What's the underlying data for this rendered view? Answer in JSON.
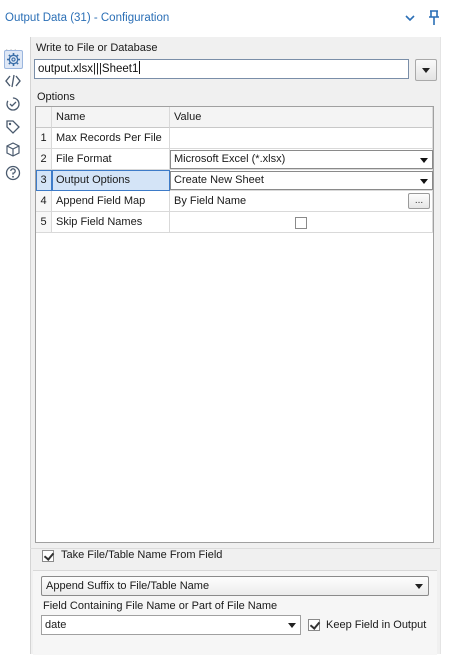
{
  "header": {
    "title": "Output Data (31) - Configuration"
  },
  "sidebar": {
    "more": "...",
    "tools": [
      "gear-icon",
      "xml-icon",
      "anchor-icon",
      "tag-icon",
      "cube-icon",
      "help-icon"
    ]
  },
  "target": {
    "label": "Write to File or Database",
    "value": "output.xlsx|||Sheet1"
  },
  "options": {
    "label": "Options",
    "columns": [
      "Name",
      "Value"
    ],
    "rows": [
      {
        "num": "1",
        "name": "Max Records Per File",
        "value": ""
      },
      {
        "num": "2",
        "name": "File Format",
        "value": "Microsoft Excel (*.xlsx)"
      },
      {
        "num": "3",
        "name": "Output Options",
        "value": "Create New Sheet"
      },
      {
        "num": "4",
        "name": "Append Field Map",
        "value": "By Field Name",
        "button": "..."
      },
      {
        "num": "5",
        "name": "Skip Field Names",
        "checked": false
      }
    ]
  },
  "bottom": {
    "take_name_label": "Take File/Table Name From Field",
    "take_name_checked": true,
    "suffix_option": "Append Suffix to File/Table Name",
    "field_label": "Field Containing File Name or Part of File Name",
    "field_value": "date",
    "keep_field_label": "Keep Field in Output",
    "keep_field_checked": true
  },
  "colors": {
    "title": "#2b6fb6",
    "selection": "#d4e4f7",
    "selection_border": "#3d7bc8",
    "panel": "#f0f0f0"
  }
}
